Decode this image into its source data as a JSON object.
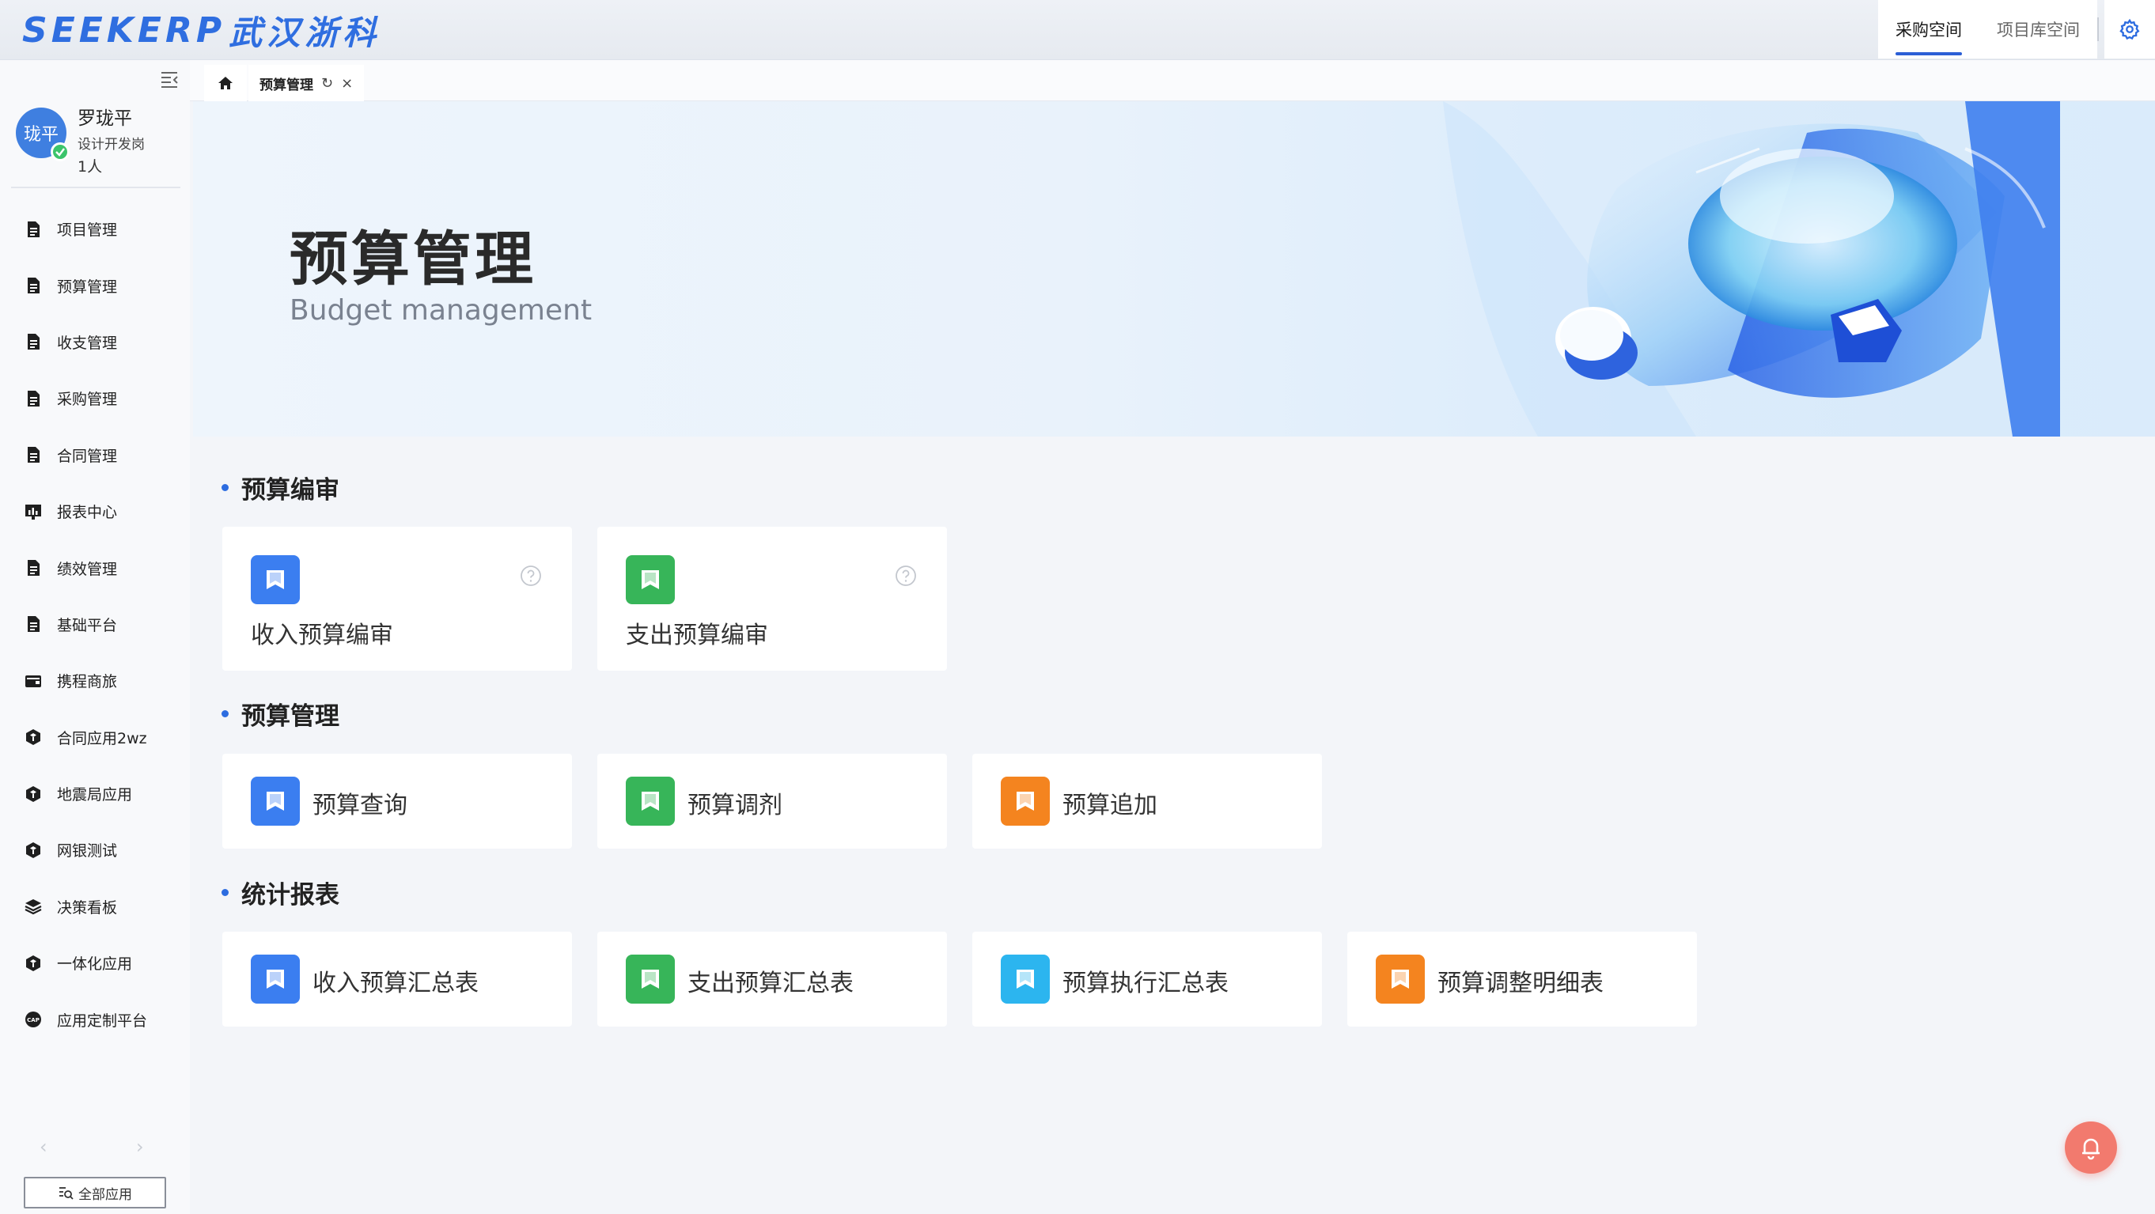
{
  "header": {
    "logo_en": "SEEKERP",
    "logo_cn": "武汉浙科",
    "space_tabs": [
      {
        "label": "采购空间",
        "active": true
      },
      {
        "label": "项目库空间",
        "active": false
      }
    ]
  },
  "sidebar": {
    "user": {
      "avatar_text": "珑平",
      "name": "罗珑平",
      "role": "设计开发岗",
      "count": "1人"
    },
    "items": [
      {
        "label": "项目管理",
        "icon": "document-icon"
      },
      {
        "label": "预算管理",
        "icon": "document-icon"
      },
      {
        "label": "收支管理",
        "icon": "document-icon"
      },
      {
        "label": "采购管理",
        "icon": "document-icon"
      },
      {
        "label": "合同管理",
        "icon": "document-icon"
      },
      {
        "label": "报表中心",
        "icon": "chart-icon"
      },
      {
        "label": "绩效管理",
        "icon": "document-icon"
      },
      {
        "label": "基础平台",
        "icon": "document-icon"
      },
      {
        "label": "携程商旅",
        "icon": "wallet-icon"
      },
      {
        "label": "合同应用2wz",
        "icon": "cube-icon"
      },
      {
        "label": "地震局应用",
        "icon": "cube-icon"
      },
      {
        "label": "网银测试",
        "icon": "cube-icon"
      },
      {
        "label": "决策看板",
        "icon": "layers-icon"
      },
      {
        "label": "一体化应用",
        "icon": "cube-icon"
      },
      {
        "label": "应用定制平台",
        "icon": "cap-icon"
      }
    ],
    "pager_prev": "‹",
    "pager_next": "›",
    "all_apps_label": "全部应用"
  },
  "tabs": {
    "active_tab_label": "预算管理",
    "refresh_glyph": "↻",
    "close_glyph": "×"
  },
  "banner": {
    "title": "预算管理",
    "subtitle": "Budget management"
  },
  "sections": [
    {
      "title": "预算编审",
      "cards": [
        {
          "label": "收入预算编审",
          "color": "#3b7ef0",
          "help": true
        },
        {
          "label": "支出预算编审",
          "color": "#37b559",
          "help": true
        }
      ]
    },
    {
      "title": "预算管理",
      "cards": [
        {
          "label": "预算查询",
          "color": "#3b7ef0"
        },
        {
          "label": "预算调剂",
          "color": "#37b559"
        },
        {
          "label": "预算追加",
          "color": "#f4841f"
        }
      ]
    },
    {
      "title": "统计报表",
      "cards": [
        {
          "label": "收入预算汇总表",
          "color": "#3b7ef0"
        },
        {
          "label": "支出预算汇总表",
          "color": "#37b559"
        },
        {
          "label": "预算执行汇总表",
          "color": "#2cb5ef"
        },
        {
          "label": "预算调整明细表",
          "color": "#f4841f"
        }
      ]
    }
  ],
  "colors": {
    "accent": "#2c6ce0",
    "notify": "#f27a6e"
  }
}
